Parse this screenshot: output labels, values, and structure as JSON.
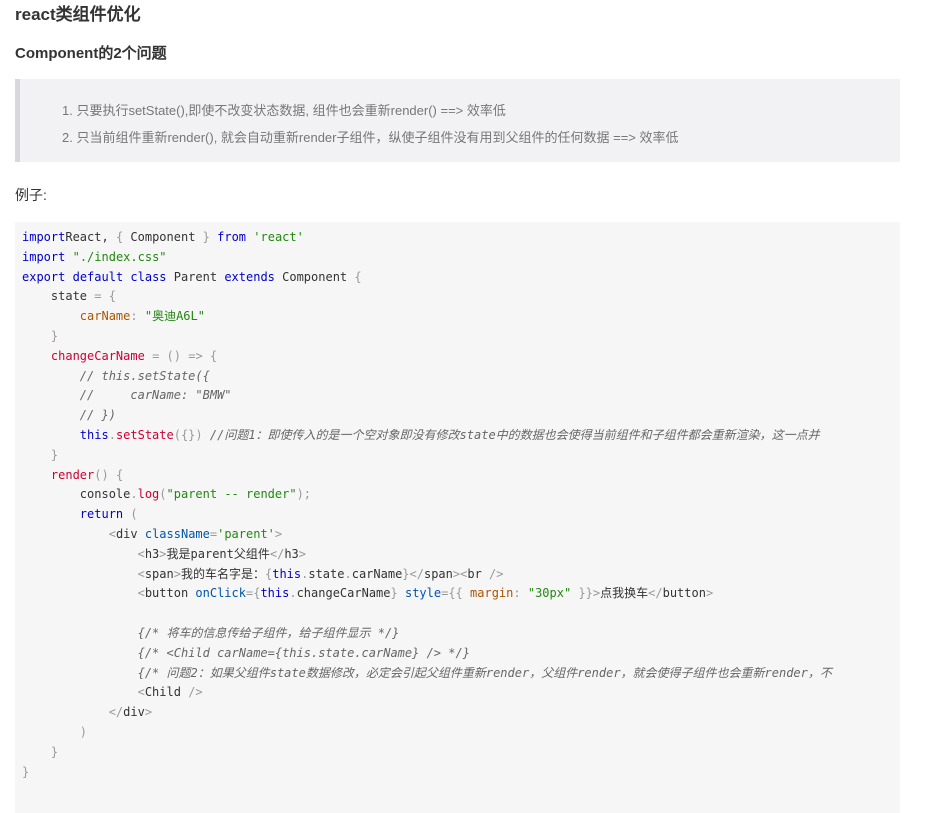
{
  "heading": "react类组件优化",
  "subheading": "Component的2个问题",
  "problems": [
    "1. 只要执行setState(),即使不改变状态数据, 组件也会重新render() ==> 效率低",
    "2. 只当前组件重新render(), 就会自动重新render子组件，纵使子组件没有用到父组件的任何数据 ==> 效率低"
  ],
  "example_label": "例子:",
  "code": {
    "lines": [
      [
        [
          "kw",
          "import"
        ],
        [
          "",
          "React, "
        ],
        [
          "pn",
          "{"
        ],
        [
          "",
          " Component "
        ],
        [
          "pn",
          "}"
        ],
        [
          "",
          " "
        ],
        [
          "kw",
          "from"
        ],
        [
          "",
          " "
        ],
        [
          "str",
          "'react'"
        ]
      ],
      [
        [
          "kw",
          "import"
        ],
        [
          "",
          " "
        ],
        [
          "str",
          "\"./index.css\""
        ]
      ],
      [
        [
          "kw",
          "export"
        ],
        [
          "",
          " "
        ],
        [
          "kw",
          "default"
        ],
        [
          "",
          " "
        ],
        [
          "kw",
          "class"
        ],
        [
          "",
          " Parent "
        ],
        [
          "kw",
          "extends"
        ],
        [
          "",
          " Component "
        ],
        [
          "pn",
          "{"
        ]
      ],
      [
        [
          "",
          "    state "
        ],
        [
          "pn",
          "="
        ],
        [
          "",
          " "
        ],
        [
          "pn",
          "{"
        ]
      ],
      [
        [
          "",
          "        "
        ],
        [
          "prop",
          "carName"
        ],
        [
          "pn",
          ":"
        ],
        [
          "",
          " "
        ],
        [
          "str",
          "\"奥迪A6L\""
        ]
      ],
      [
        [
          "",
          "    "
        ],
        [
          "pn",
          "}"
        ]
      ],
      [
        [
          "",
          "    "
        ],
        [
          "fn",
          "changeCarName"
        ],
        [
          "",
          " "
        ],
        [
          "pn",
          "="
        ],
        [
          "",
          " "
        ],
        [
          "pn",
          "()"
        ],
        [
          "",
          " "
        ],
        [
          "pn",
          "=>"
        ],
        [
          "",
          " "
        ],
        [
          "pn",
          "{"
        ]
      ],
      [
        [
          "",
          "        "
        ],
        [
          "cm",
          "// this.setState({"
        ]
      ],
      [
        [
          "",
          "        "
        ],
        [
          "cm",
          "//     carName: \"BMW\""
        ]
      ],
      [
        [
          "",
          "        "
        ],
        [
          "cm",
          "// })"
        ]
      ],
      [
        [
          "",
          "        "
        ],
        [
          "kw",
          "this"
        ],
        [
          "pn",
          "."
        ],
        [
          "fn",
          "setState"
        ],
        [
          "pn",
          "({})"
        ],
        [
          "",
          " "
        ],
        [
          "cm",
          "//问题1：即使传入的是一个空对象即没有修改state中的数据也会使得当前组件和子组件都会重新渲染，这一点并"
        ]
      ],
      [
        [
          "",
          "    "
        ],
        [
          "pn",
          "}"
        ]
      ],
      [
        [
          "",
          "    "
        ],
        [
          "fn",
          "render"
        ],
        [
          "pn",
          "()"
        ],
        [
          "",
          " "
        ],
        [
          "pn",
          "{"
        ]
      ],
      [
        [
          "",
          "        console"
        ],
        [
          "pn",
          "."
        ],
        [
          "fn",
          "log"
        ],
        [
          "pn",
          "("
        ],
        [
          "str",
          "\"parent -- render\""
        ],
        [
          "pn",
          ");"
        ]
      ],
      [
        [
          "",
          "        "
        ],
        [
          "kw",
          "return"
        ],
        [
          "",
          " "
        ],
        [
          "pn",
          "("
        ]
      ],
      [
        [
          "",
          "            "
        ],
        [
          "pn",
          "<"
        ],
        [
          "",
          "div "
        ],
        [
          "at",
          "className"
        ],
        [
          "pn",
          "="
        ],
        [
          "str",
          "'parent'"
        ],
        [
          "pn",
          ">"
        ]
      ],
      [
        [
          "",
          "                "
        ],
        [
          "pn",
          "<"
        ],
        [
          "",
          "h3"
        ],
        [
          "pn",
          ">"
        ],
        [
          "",
          "我是parent父组件"
        ],
        [
          "pn",
          "</"
        ],
        [
          "",
          "h3"
        ],
        [
          "pn",
          ">"
        ]
      ],
      [
        [
          "",
          "                "
        ],
        [
          "pn",
          "<"
        ],
        [
          "",
          "span"
        ],
        [
          "pn",
          ">"
        ],
        [
          "",
          "我的车名字是："
        ],
        [
          "pn",
          "{"
        ],
        [
          "kw",
          "this"
        ],
        [
          "pn",
          "."
        ],
        [
          "",
          "state"
        ],
        [
          "pn",
          "."
        ],
        [
          "",
          "carName"
        ],
        [
          "pn",
          "}</"
        ],
        [
          "",
          "span"
        ],
        [
          "pn",
          ">"
        ],
        [
          "pn",
          "<"
        ],
        [
          "",
          "br "
        ],
        [
          "pn",
          "/>"
        ]
      ],
      [
        [
          "",
          "                "
        ],
        [
          "pn",
          "<"
        ],
        [
          "",
          "button "
        ],
        [
          "at",
          "onClick"
        ],
        [
          "pn",
          "={"
        ],
        [
          "kw",
          "this"
        ],
        [
          "pn",
          "."
        ],
        [
          "",
          "changeCarName"
        ],
        [
          "pn",
          "}"
        ],
        [
          "",
          " "
        ],
        [
          "at",
          "style"
        ],
        [
          "pn",
          "={{"
        ],
        [
          "",
          " "
        ],
        [
          "prop",
          "margin"
        ],
        [
          "pn",
          ":"
        ],
        [
          "",
          " "
        ],
        [
          "str",
          "\"30px\""
        ],
        [
          "",
          " "
        ],
        [
          "pn",
          "}}>"
        ],
        [
          "",
          "点我换车"
        ],
        [
          "pn",
          "</"
        ],
        [
          "",
          "button"
        ],
        [
          "pn",
          ">"
        ]
      ],
      [
        [
          "",
          " "
        ]
      ],
      [
        [
          "",
          "                "
        ],
        [
          "cm",
          "{/* 将车的信息传给子组件，给子组件显示 */}"
        ]
      ],
      [
        [
          "",
          "                "
        ],
        [
          "cm",
          "{/* <Child carName={this.state.carName} /> */}"
        ]
      ],
      [
        [
          "",
          "                "
        ],
        [
          "cm",
          "{/* 问题2：如果父组件state数据修改，必定会引起父组件重新render，父组件render，就会使得子组件也会重新render，不"
        ]
      ],
      [
        [
          "",
          "                "
        ],
        [
          "pn",
          "<"
        ],
        [
          "",
          "Child "
        ],
        [
          "pn",
          "/>"
        ]
      ],
      [
        [
          "",
          "            "
        ],
        [
          "pn",
          "</"
        ],
        [
          "",
          "div"
        ],
        [
          "pn",
          ">"
        ]
      ],
      [
        [
          "",
          "        "
        ],
        [
          "pn",
          ")"
        ]
      ],
      [
        [
          "",
          "    "
        ],
        [
          "pn",
          "}"
        ]
      ],
      [
        [
          "pn",
          "}"
        ]
      ]
    ]
  }
}
